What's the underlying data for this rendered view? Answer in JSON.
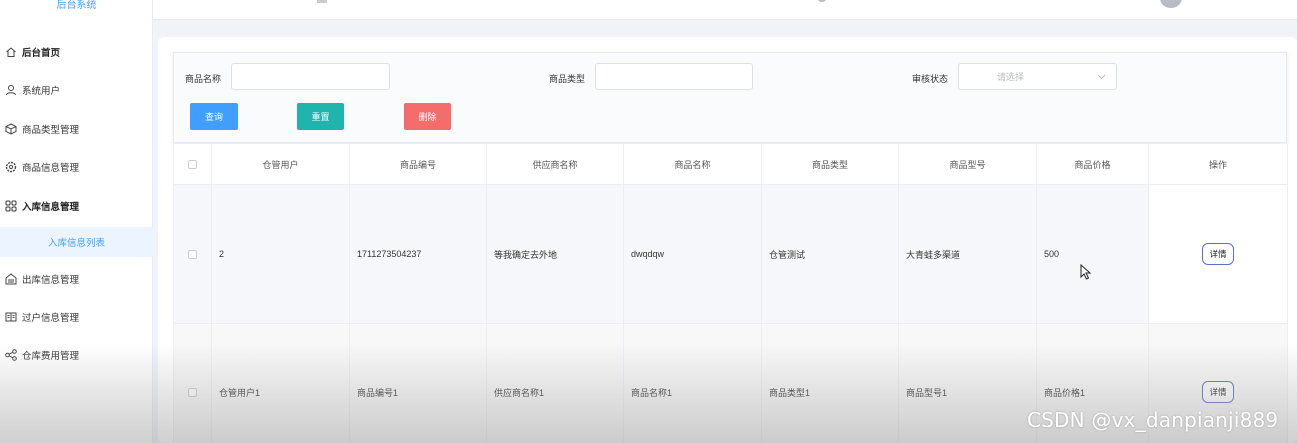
{
  "brand": "后台系统",
  "sidebar": {
    "items": [
      {
        "label": "后台首页",
        "icon": "home-icon"
      },
      {
        "label": "系统用户",
        "icon": "user-icon"
      },
      {
        "label": "商品类型管理",
        "icon": "box-icon"
      },
      {
        "label": "商品信息管理",
        "icon": "gear-icon"
      },
      {
        "label": "入库信息管理",
        "icon": "grid-icon"
      },
      {
        "label": "入库信息列表",
        "icon": ""
      },
      {
        "label": "出库信息管理",
        "icon": "inbox-icon"
      },
      {
        "label": "过户信息管理",
        "icon": "book-icon"
      },
      {
        "label": "仓库费用管理",
        "icon": "share-icon"
      }
    ]
  },
  "search": {
    "name_label": "商品名称",
    "type_label": "商品类型",
    "status_label": "审核状态",
    "status_placeholder": "请选择",
    "query_btn": "查询",
    "reset_btn": "重置",
    "delete_btn": "删除"
  },
  "table": {
    "headers": [
      "仓管用户",
      "商品编号",
      "供应商名称",
      "商品名称",
      "商品类型",
      "商品型号",
      "商品价格",
      "操作"
    ],
    "rows": [
      {
        "c1": "2",
        "c2": "1711273504237",
        "c3": "等我确定去外地",
        "c4": "dwqdqw",
        "c5": "仓管测试",
        "c6": "大青蛙多渠道",
        "c7": "500",
        "action": "详情"
      },
      {
        "c1": "仓管用户1",
        "c2": "商品编号1",
        "c3": "供应商名称1",
        "c4": "商品名称1",
        "c5": "商品类型1",
        "c6": "商品型号1",
        "c7": "商品价格1",
        "action": "详情"
      }
    ]
  },
  "colors": {
    "primary": "#409eff",
    "success": "#1fb5ac",
    "danger": "#f56c6c"
  },
  "watermark": "CSDN @vx_danpianji889"
}
